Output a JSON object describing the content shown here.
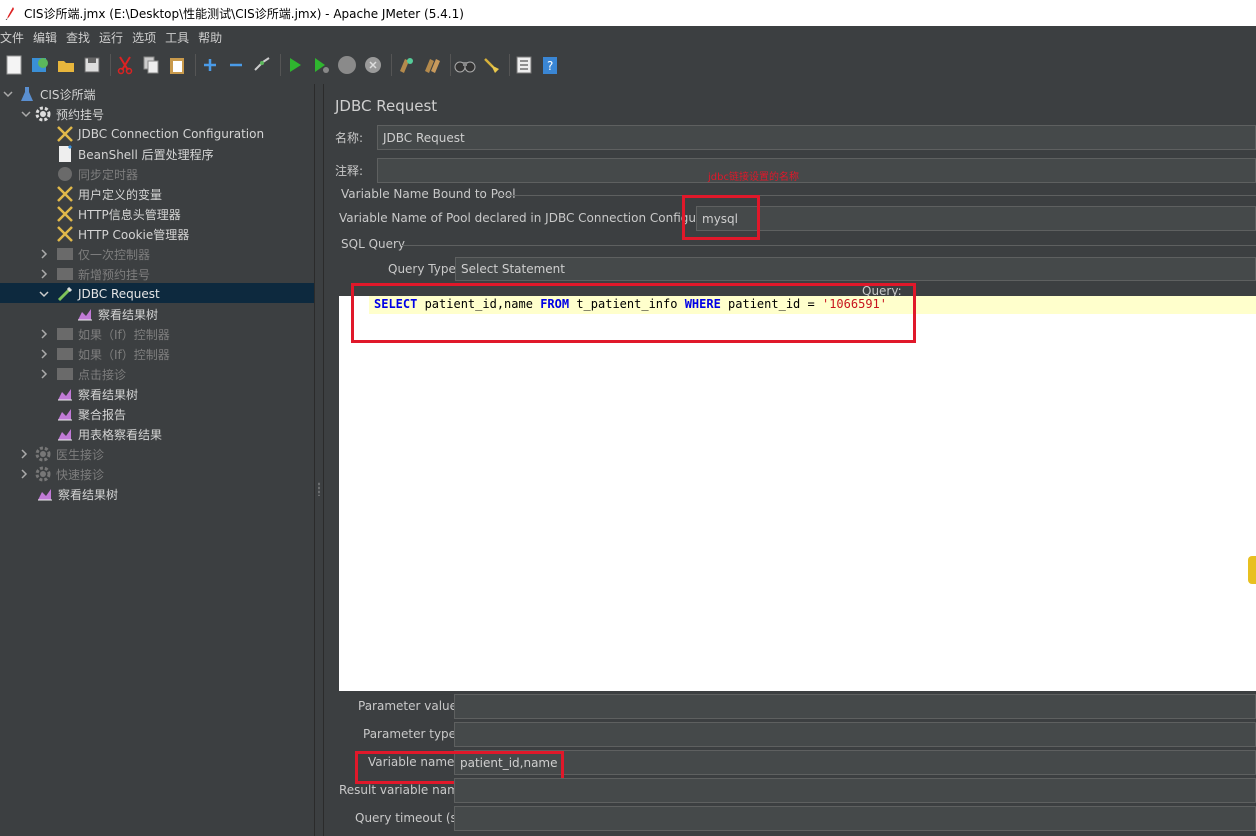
{
  "window": {
    "title": "CIS诊所端.jmx (E:\\Desktop\\性能测试\\CIS诊所端.jmx) - Apache JMeter (5.4.1)"
  },
  "menu": [
    "文件",
    "编辑",
    "查找",
    "运行",
    "选项",
    "工具",
    "帮助"
  ],
  "tree": {
    "root": "CIS诊所端",
    "group1": "预约挂号",
    "items": [
      "JDBC Connection Configuration",
      "BeanShell 后置处理程序",
      "同步定时器",
      "用户定义的变量",
      "HTTP信息头管理器",
      "HTTP Cookie管理器",
      "仅一次控制器",
      "新增预约挂号",
      "JDBC Request",
      "察看结果树",
      "如果（If）控制器",
      "如果（If）控制器",
      "点击接诊",
      "察看结果树",
      "聚合报告",
      "用表格察看结果"
    ],
    "group2": "医生接诊",
    "group3": "快速接诊",
    "last": "察看结果树"
  },
  "panel": {
    "title": "JDBC Request",
    "name_label": "名称:",
    "name_value": "JDBC Request",
    "comment_label": "注释:",
    "comment_value": "",
    "pool_group": "Variable Name Bound to Pool",
    "pool_label": "Variable Name of Pool declared in JDBC Connection Configuration:",
    "pool_value": "mysql",
    "annotation": "jdbc链接设置的名称",
    "sql_group": "SQL Query",
    "query_type_label": "Query Type:",
    "query_type_value": "Select Statement",
    "query_label": "Query:",
    "sql": {
      "kw1": "SELECT",
      "t1": " patient_id,name ",
      "kw2": "FROM",
      "t2": " t_patient_info ",
      "kw3": "WHERE",
      "t3": " patient_id = ",
      "str": "'1066591'"
    },
    "param_values_label": "Parameter values:",
    "param_types_label": "Parameter types:",
    "var_names_label": "Variable names:",
    "var_names_value": "patient_id,name",
    "result_var_label": "Result variable name:",
    "timeout_label": "Query timeout (s):"
  },
  "colors": {
    "selection": "#0d293e",
    "annotation": "#e0182a",
    "background": "#3c3f41"
  }
}
